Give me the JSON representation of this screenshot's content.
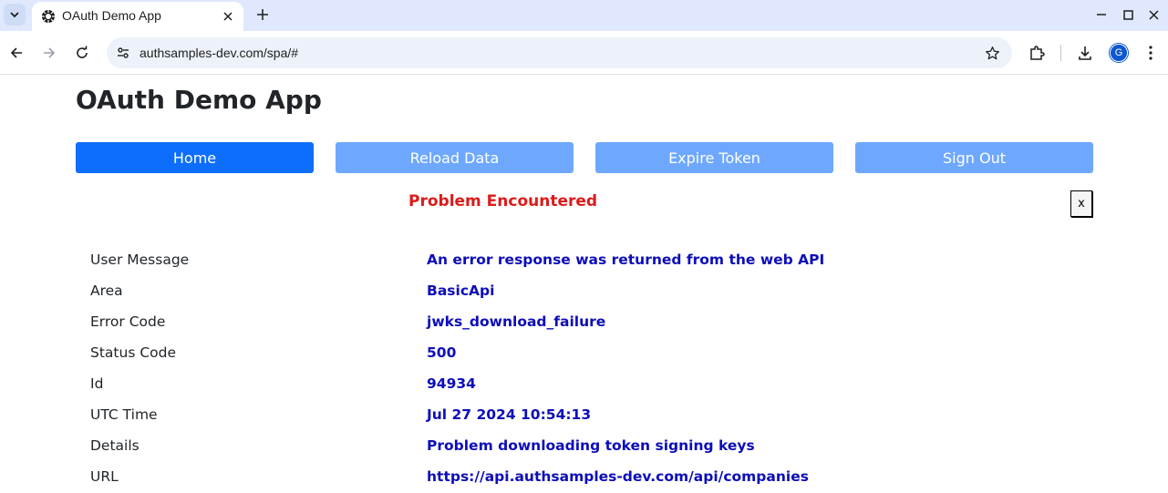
{
  "browser": {
    "tab_title": "OAuth Demo App",
    "url": "authsamples-dev.com/spa/#",
    "profile_initial": "G"
  },
  "app": {
    "title": "OAuth Demo App",
    "nav": [
      {
        "label": "Home",
        "state": "active"
      },
      {
        "label": "Reload Data",
        "state": "inactive"
      },
      {
        "label": "Expire Token",
        "state": "inactive"
      },
      {
        "label": "Sign Out",
        "state": "inactive"
      }
    ]
  },
  "error": {
    "heading": "Problem Encountered",
    "close_label": "x",
    "rows": [
      {
        "label": "User Message",
        "value": "An error response was returned from the web API"
      },
      {
        "label": "Area",
        "value": "BasicApi"
      },
      {
        "label": "Error Code",
        "value": "jwks_download_failure"
      },
      {
        "label": "Status Code",
        "value": "500"
      },
      {
        "label": "Id",
        "value": "94934"
      },
      {
        "label": "UTC Time",
        "value": "Jul 27 2024 10:54:13"
      },
      {
        "label": "Details",
        "value": "Problem downloading token signing keys"
      },
      {
        "label": "URL",
        "value": "https://api.authsamples-dev.com/api/companies"
      }
    ]
  },
  "colors": {
    "primary": "#0d6efd",
    "primary_muted": "#6ea8fe",
    "error_heading": "#dc1a1a",
    "error_value": "#0d0dba"
  }
}
